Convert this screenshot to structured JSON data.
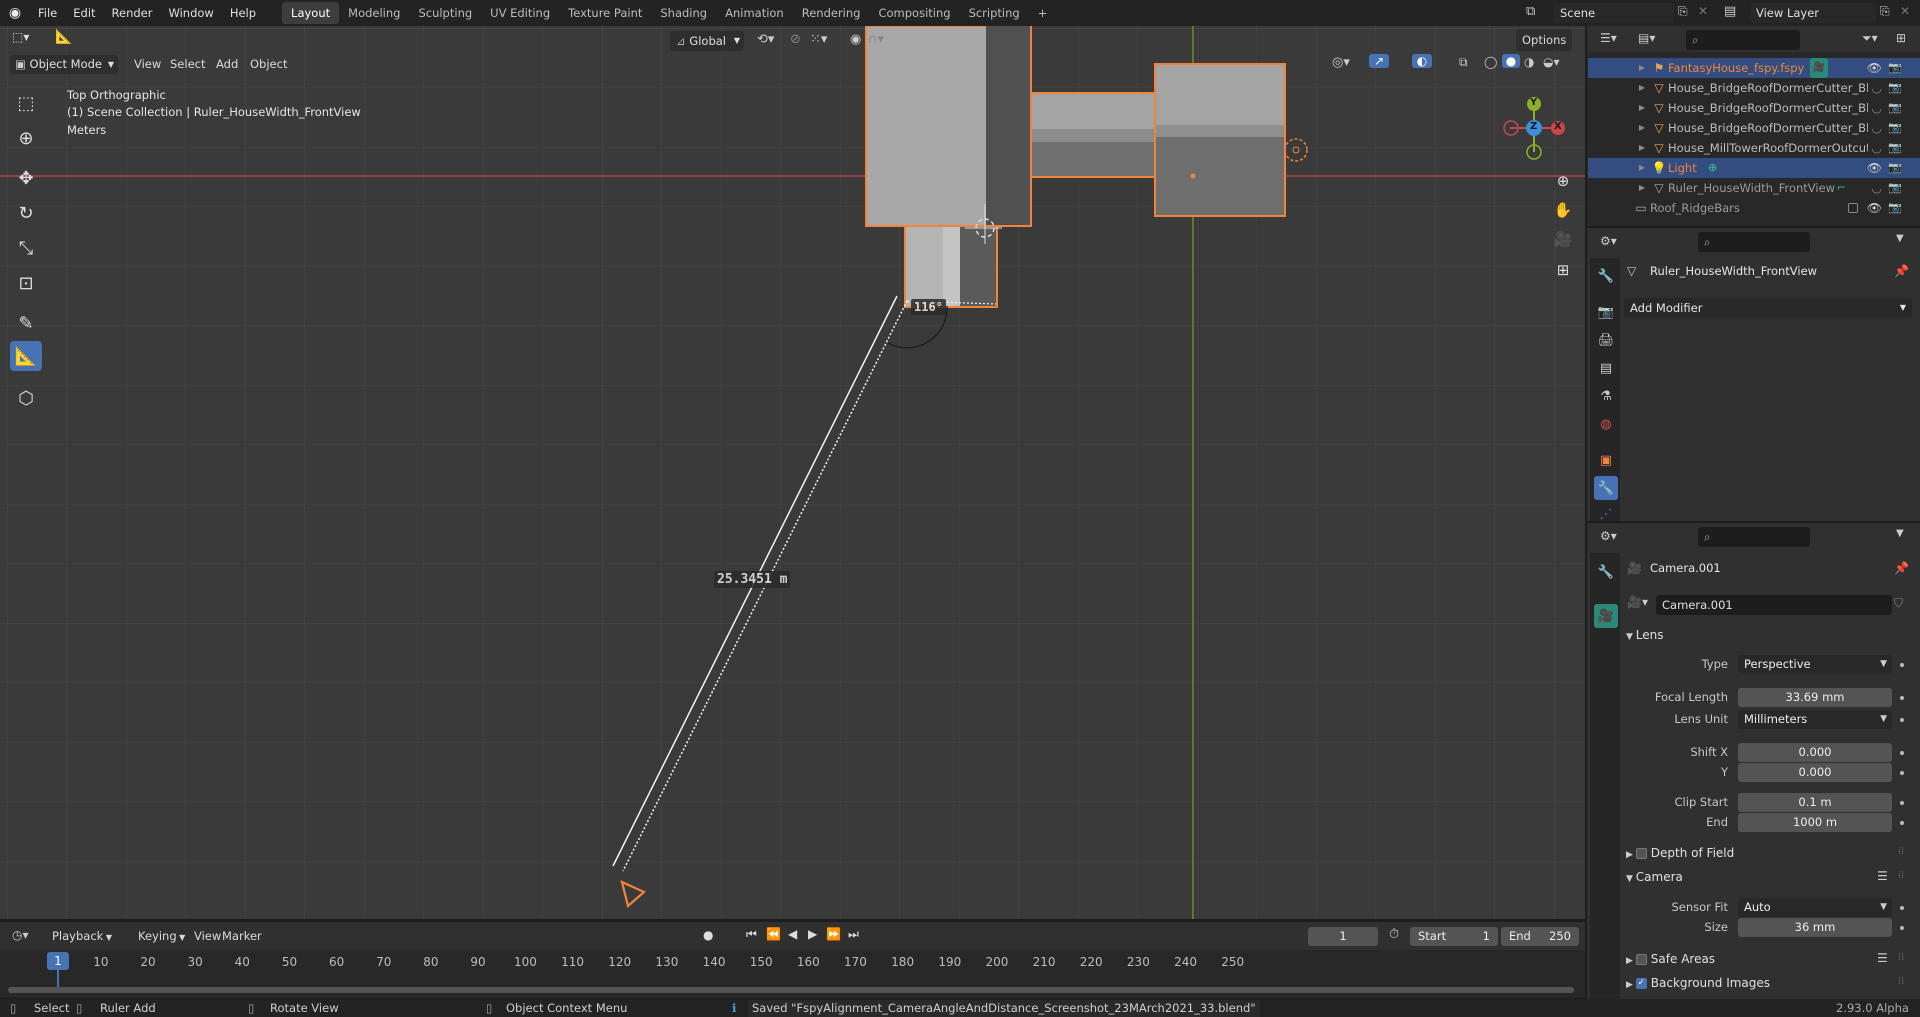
{
  "topbar": {
    "menus": [
      "File",
      "Edit",
      "Render",
      "Window",
      "Help"
    ],
    "workspaces": [
      "Layout",
      "Modeling",
      "Sculpting",
      "UV Editing",
      "Texture Paint",
      "Shading",
      "Animation",
      "Rendering",
      "Compositing",
      "Scripting"
    ],
    "active_workspace": "Layout",
    "add_tab": "+",
    "scene": "Scene",
    "view_layer": "View Layer"
  },
  "viewport_header": {
    "mode": "Object Mode",
    "menus": [
      "View",
      "Select",
      "Add",
      "Object"
    ],
    "orientation": "Global",
    "options": "Options"
  },
  "viewport": {
    "view_name": "Top Orthographic",
    "collection_info": "(1) Scene Collection | Ruler_HouseWidth_FrontView",
    "units": "Meters",
    "ruler_angle": "116°",
    "ruler_length": "25.3451 m",
    "gizmo": {
      "y": "Y",
      "z": "Z",
      "x": "X"
    }
  },
  "outliner": {
    "items": [
      {
        "label": "FantasyHouse_fspy.fspy",
        "type": "camera",
        "selected": true,
        "color": "#f0843c"
      },
      {
        "label": "House_BridgeRoofDormerCutter_Blc",
        "type": "mesh",
        "selected": false,
        "color": "#bdbdbd"
      },
      {
        "label": "House_BridgeRoofDormerCutter_Blc",
        "type": "mesh",
        "selected": false,
        "color": "#bdbdbd"
      },
      {
        "label": "House_BridgeRoofDormerCutter_Blc",
        "type": "mesh",
        "selected": false,
        "color": "#bdbdbd"
      },
      {
        "label": "House_MillTowerRoofDormerOutcut",
        "type": "mesh",
        "selected": false,
        "color": "#bdbdbd"
      },
      {
        "label": "Light",
        "type": "light",
        "selected": true,
        "color": "#f0843c"
      },
      {
        "label": "Ruler_HouseWidth_FrontView",
        "type": "mesh",
        "selected": false,
        "color": "#9a9a9a"
      },
      {
        "label": "Roof_RidgeBars",
        "type": "collection",
        "selected": false,
        "color": "#9a9a9a"
      }
    ]
  },
  "modifier_panel": {
    "object_name": "Ruler_HouseWidth_FrontView",
    "add_modifier": "Add Modifier"
  },
  "camera_panel": {
    "object_name": "Camera.001",
    "data_name": "Camera.001",
    "lens_section": "Lens",
    "type_label": "Type",
    "type_value": "Perspective",
    "focal_length_label": "Focal Length",
    "focal_length_value": "33.69 mm",
    "lens_unit_label": "Lens Unit",
    "lens_unit_value": "Millimeters",
    "shift_x_label": "Shift X",
    "shift_x_value": "0.000",
    "shift_y_label": "Y",
    "shift_y_value": "0.000",
    "clip_start_label": "Clip Start",
    "clip_start_value": "0.1 m",
    "clip_end_label": "End",
    "clip_end_value": "1000 m",
    "dof_section": "Depth of Field",
    "camera_section": "Camera",
    "sensor_fit_label": "Sensor Fit",
    "sensor_fit_value": "Auto",
    "size_label": "Size",
    "size_value": "36 mm",
    "safe_areas_section": "Safe Areas",
    "background_images_section": "Background Images"
  },
  "timeline": {
    "menus": [
      "Playback",
      "Keying",
      "View",
      "Marker"
    ],
    "current_frame": "1",
    "start_label": "Start",
    "start_value": "1",
    "end_label": "End",
    "end_value": "250",
    "ruler_ticks": [
      "10",
      "20",
      "30",
      "40",
      "50",
      "60",
      "70",
      "80",
      "90",
      "100",
      "110",
      "120",
      "130",
      "140",
      "150",
      "160",
      "170",
      "180",
      "190",
      "200",
      "210",
      "220",
      "230",
      "240",
      "250"
    ],
    "playhead": "1"
  },
  "statusbar": {
    "select": "Select",
    "ruler_add": "Ruler Add",
    "rotate_view": "Rotate View",
    "context_menu": "Object Context Menu",
    "message": "Saved \"FspyAlignment_CameraAngleAndDistance_Screenshot_23MArch2021_33.blend\"",
    "version": "2.93.0 Alpha"
  },
  "colors": {
    "accent": "#4772b3",
    "selection": "#f0843c",
    "x_axis": "#c8464b",
    "y_axis": "#8db02c",
    "z_axis": "#3a8fd9"
  }
}
